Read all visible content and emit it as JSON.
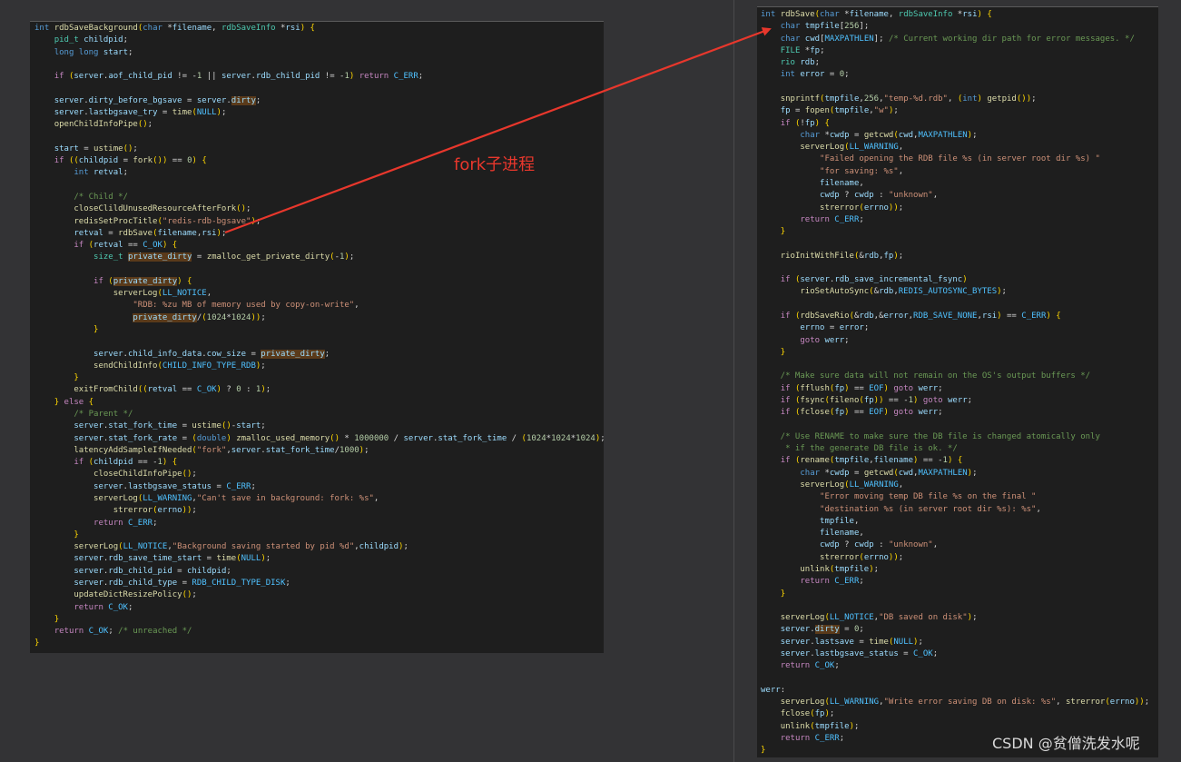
{
  "left_panel": {
    "lines": [
      "int rdbSaveBackground(char *filename, rdbSaveInfo *rsi) {",
      "    pid_t childpid;",
      "    long long start;",
      "",
      "    if (server.aof_child_pid != -1 || server.rdb_child_pid != -1) return C_ERR;",
      "",
      "    server.dirty_before_bgsave = server.dirty;",
      "    server.lastbgsave_try = time(NULL);",
      "    openChildInfoPipe();",
      "",
      "    start = ustime();",
      "    if ((childpid = fork()) == 0) {",
      "        int retval;",
      "",
      "        /* Child */",
      "        closeClildUnusedResourceAfterFork();",
      "        redisSetProcTitle(\"redis-rdb-bgsave\");",
      "        retval = rdbSave(filename,rsi);",
      "        if (retval == C_OK) {",
      "            size_t private_dirty = zmalloc_get_private_dirty(-1);",
      "",
      "            if (private_dirty) {",
      "                serverLog(LL_NOTICE,",
      "                    \"RDB: %zu MB of memory used by copy-on-write\",",
      "                    private_dirty/(1024*1024));",
      "            }",
      "",
      "            server.child_info_data.cow_size = private_dirty;",
      "            sendChildInfo(CHILD_INFO_TYPE_RDB);",
      "        }",
      "        exitFromChild((retval == C_OK) ? 0 : 1);",
      "    } else {",
      "        /* Parent */",
      "        server.stat_fork_time = ustime()-start;",
      "        server.stat_fork_rate = (double) zmalloc_used_memory() * 1000000 / server.stat_fork_time / (1024*1024*1024);",
      "        latencyAddSampleIfNeeded(\"fork\",server.stat_fork_time/1000);",
      "        if (childpid == -1) {",
      "            closeChildInfoPipe();",
      "            server.lastbgsave_status = C_ERR;",
      "            serverLog(LL_WARNING,\"Can't save in background: fork: %s\",",
      "                strerror(errno));",
      "            return C_ERR;",
      "        }",
      "        serverLog(LL_NOTICE,\"Background saving started by pid %d\",childpid);",
      "        server.rdb_save_time_start = time(NULL);",
      "        server.rdb_child_pid = childpid;",
      "        server.rdb_child_type = RDB_CHILD_TYPE_DISK;",
      "        updateDictResizePolicy();",
      "        return C_OK;",
      "    }",
      "    return C_OK; /* unreached */",
      "}"
    ]
  },
  "right_panel": {
    "lines": [
      "int rdbSave(char *filename, rdbSaveInfo *rsi) {",
      "    char tmpfile[256];",
      "    char cwd[MAXPATHLEN]; /* Current working dir path for error messages. */",
      "    FILE *fp;",
      "    rio rdb;",
      "    int error = 0;",
      "",
      "    snprintf(tmpfile,256,\"temp-%d.rdb\", (int) getpid());",
      "    fp = fopen(tmpfile,\"w\");",
      "    if (!fp) {",
      "        char *cwdp = getcwd(cwd,MAXPATHLEN);",
      "        serverLog(LL_WARNING,",
      "            \"Failed opening the RDB file %s (in server root dir %s) \"",
      "            \"for saving: %s\",",
      "            filename,",
      "            cwdp ? cwdp : \"unknown\",",
      "            strerror(errno));",
      "        return C_ERR;",
      "    }",
      "",
      "    rioInitWithFile(&rdb,fp);",
      "",
      "    if (server.rdb_save_incremental_fsync)",
      "        rioSetAutoSync(&rdb,REDIS_AUTOSYNC_BYTES);",
      "",
      "    if (rdbSaveRio(&rdb,&error,RDB_SAVE_NONE,rsi) == C_ERR) {",
      "        errno = error;",
      "        goto werr;",
      "    }",
      "",
      "    /* Make sure data will not remain on the OS's output buffers */",
      "    if (fflush(fp) == EOF) goto werr;",
      "    if (fsync(fileno(fp)) == -1) goto werr;",
      "    if (fclose(fp) == EOF) goto werr;",
      "",
      "    /* Use RENAME to make sure the DB file is changed atomically only",
      "     * if the generate DB file is ok. */",
      "    if (rename(tmpfile,filename) == -1) {",
      "        char *cwdp = getcwd(cwd,MAXPATHLEN);",
      "        serverLog(LL_WARNING,",
      "            \"Error moving temp DB file %s on the final \"",
      "            \"destination %s (in server root dir %s): %s\",",
      "            tmpfile,",
      "            filename,",
      "            cwdp ? cwdp : \"unknown\",",
      "            strerror(errno));",
      "        unlink(tmpfile);",
      "        return C_ERR;",
      "    }",
      "",
      "    serverLog(LL_NOTICE,\"DB saved on disk\");",
      "    server.dirty = 0;",
      "    server.lastsave = time(NULL);",
      "    server.lastbgsave_status = C_OK;",
      "    return C_OK;",
      "",
      "werr:",
      "    serverLog(LL_WARNING,\"Write error saving DB on disk: %s\", strerror(errno));",
      "    fclose(fp);",
      "    unlink(tmpfile);",
      "    return C_ERR;",
      "}"
    ]
  },
  "annotation": {
    "text": "fork子进程",
    "color": "#e8372c"
  },
  "watermark": {
    "text": "CSDN @贫僧洗发水呢"
  },
  "colors": {
    "background": "#333335",
    "editor_bg": "#1e1e1e",
    "keyword": "#569cd6",
    "function": "#dcdcaa",
    "variable": "#9cdcfe",
    "string": "#ce9178",
    "comment": "#6a9955",
    "macro": "#4fc1ff",
    "number": "#b5cea8",
    "arrow": "#e8372c"
  }
}
